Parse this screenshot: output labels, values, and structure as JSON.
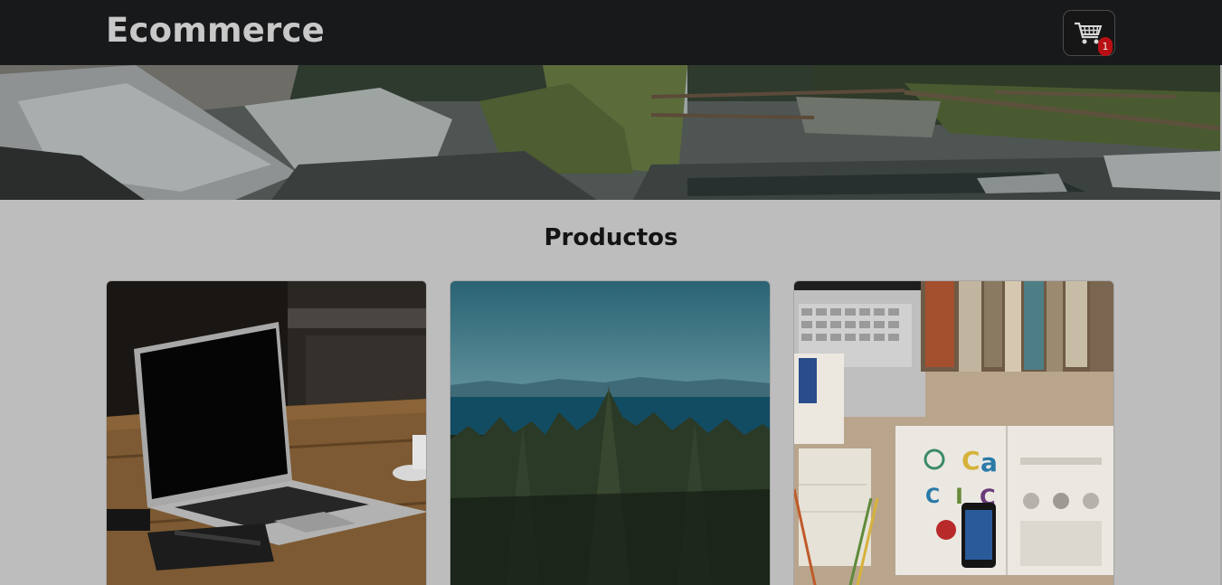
{
  "navbar": {
    "brand": "Ecommerce",
    "cart": {
      "icon": "shopping-cart-icon",
      "count": "1"
    }
  },
  "main": {
    "section_title": "Productos",
    "products": [
      {
        "image": "laptop-on-wooden-desk"
      },
      {
        "image": "forest-and-sea-landscape"
      },
      {
        "image": "desk-with-laptop-books-and-papers"
      }
    ]
  },
  "colors": {
    "navbar_bg": "#18191b",
    "page_bg": "#bdbdbd",
    "badge": "#b80f14"
  }
}
